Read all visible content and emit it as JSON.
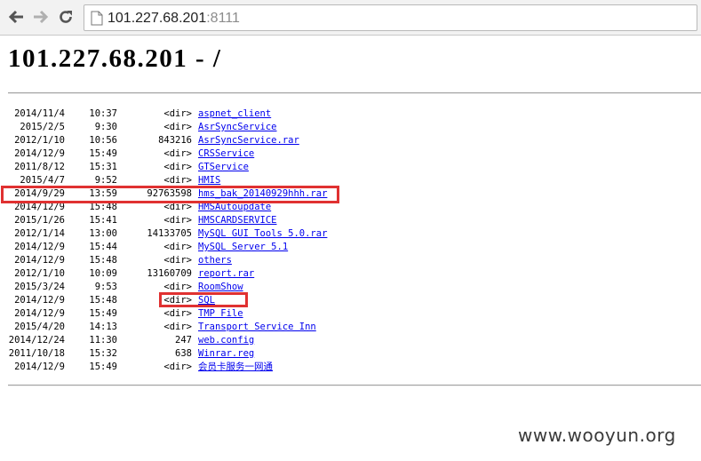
{
  "browser": {
    "url_host": "101.227.68.201",
    "url_port": ":8111"
  },
  "page": {
    "title": "101.227.68.201 - /"
  },
  "listing": [
    {
      "date": "2014/11/4",
      "time": "10:37",
      "size": "<dir>",
      "name": "aspnet_client"
    },
    {
      "date": "2015/2/5",
      "time": "9:30",
      "size": "<dir>",
      "name": "AsrSyncService"
    },
    {
      "date": "2012/1/10",
      "time": "10:56",
      "size": "843216",
      "name": "AsrSyncService.rar"
    },
    {
      "date": "2014/12/9",
      "time": "15:49",
      "size": "<dir>",
      "name": "CRSService"
    },
    {
      "date": "2011/8/12",
      "time": "15:31",
      "size": "<dir>",
      "name": "GTService"
    },
    {
      "date": "2015/4/7",
      "time": "9:52",
      "size": "<dir>",
      "name": "HMIS"
    },
    {
      "date": "2014/9/29",
      "time": "13:59",
      "size": "92763598",
      "name": "hms_bak_20140929hhh.rar"
    },
    {
      "date": "2014/12/9",
      "time": "15:48",
      "size": "<dir>",
      "name": "HMSAutoupdate"
    },
    {
      "date": "2015/1/26",
      "time": "15:41",
      "size": "<dir>",
      "name": "HMSCARDSERVICE"
    },
    {
      "date": "2012/1/14",
      "time": "13:00",
      "size": "14133705",
      "name": "MySQL GUI Tools 5.0.rar"
    },
    {
      "date": "2014/12/9",
      "time": "15:44",
      "size": "<dir>",
      "name": "MySQL Server 5.1"
    },
    {
      "date": "2014/12/9",
      "time": "15:48",
      "size": "<dir>",
      "name": "others"
    },
    {
      "date": "2012/1/10",
      "time": "10:09",
      "size": "13160709",
      "name": "report.rar"
    },
    {
      "date": "2015/3/24",
      "time": "9:53",
      "size": "<dir>",
      "name": "RoomShow"
    },
    {
      "date": "2014/12/9",
      "time": "15:48",
      "size": "<dir>",
      "name": "SQL"
    },
    {
      "date": "2014/12/9",
      "time": "15:49",
      "size": "<dir>",
      "name": "TMP File"
    },
    {
      "date": "2015/4/20",
      "time": "14:13",
      "size": "<dir>",
      "name": "Transport Service Inn"
    },
    {
      "date": "2014/12/24",
      "time": "11:30",
      "size": "247",
      "name": "web.config"
    },
    {
      "date": "2011/10/18",
      "time": "15:32",
      "size": "638",
      "name": "Winrar.reg"
    },
    {
      "date": "2014/12/9",
      "time": "15:49",
      "size": "<dir>",
      "name": "会员卡服务一网通"
    }
  ],
  "watermark": "www.wooyun.org",
  "colors": {
    "link": "#0000ee",
    "highlight": "#e03131"
  }
}
